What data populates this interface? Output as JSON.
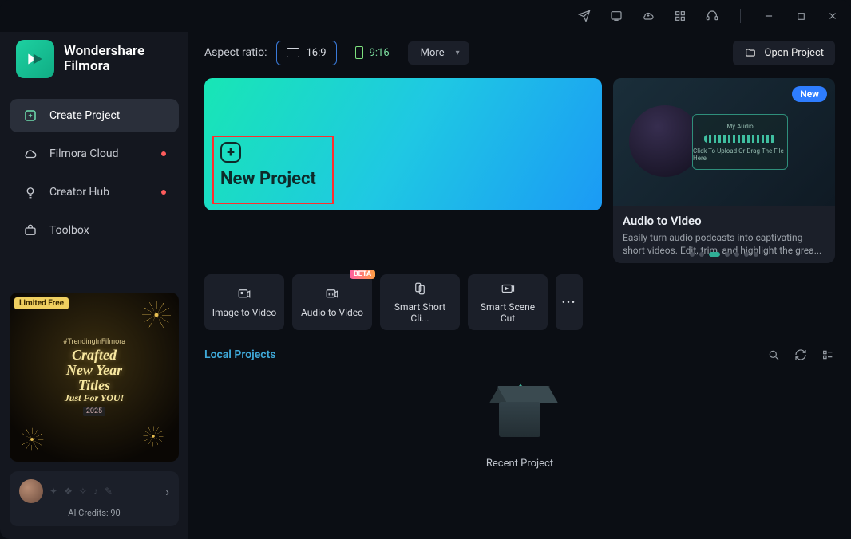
{
  "titlebar": {
    "icons": [
      "send",
      "export",
      "cloud",
      "apps",
      "support"
    ],
    "window": [
      "minimize",
      "maximize",
      "close"
    ]
  },
  "logo": {
    "line1": "Wondershare",
    "line2": "Filmora"
  },
  "sidebar": {
    "items": [
      {
        "label": "Create Project",
        "icon": "create",
        "active": true,
        "dot": false
      },
      {
        "label": "Filmora Cloud",
        "icon": "cloud",
        "active": false,
        "dot": true
      },
      {
        "label": "Creator Hub",
        "icon": "bulb",
        "active": false,
        "dot": true
      },
      {
        "label": "Toolbox",
        "icon": "toolbox",
        "active": false,
        "dot": false
      }
    ],
    "promo": {
      "ribbon": "Limited Free",
      "sub": "#TrendingInFilmora",
      "l1": "Crafted",
      "l2": "New Year",
      "l3": "Titles",
      "l4": "Just For YOU!",
      "year": "2025"
    },
    "credits": {
      "label": "AI Credits: 90"
    }
  },
  "toolbar": {
    "aspect_label": "Aspect ratio:",
    "ratio_169": "16:9",
    "ratio_916": "9:16",
    "more": "More",
    "open_project": "Open Project"
  },
  "hero": {
    "title": "New Project"
  },
  "feature": {
    "badge": "New",
    "mock_title": "My Audio",
    "mock_sub": "Click To Upload Or Drag The File Here",
    "title": "Audio to Video",
    "desc": "Easily turn audio podcasts into captivating short videos. Edit, trim, and highlight the grea..."
  },
  "tools": [
    {
      "label": "Image to Video",
      "beta": false
    },
    {
      "label": "Audio to Video",
      "beta": true
    },
    {
      "label": "Smart Short Cli...",
      "beta": false
    },
    {
      "label": "Smart Scene Cut",
      "beta": false
    }
  ],
  "section": {
    "title": "Local Projects"
  },
  "empty": {
    "label": "Recent Project"
  }
}
